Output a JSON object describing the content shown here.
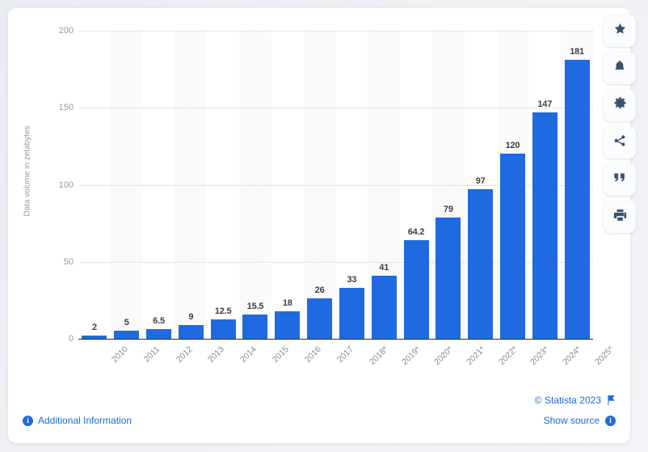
{
  "chart_data": {
    "type": "bar",
    "title": "",
    "subtitle": "",
    "xlabel": "",
    "ylabel": "Data volume in zetabytes",
    "ylim": [
      0,
      200
    ],
    "yticks": [
      0,
      50,
      100,
      150,
      200
    ],
    "ytick_labels": [
      "0",
      "50",
      "100",
      "150",
      "200"
    ],
    "grid": true,
    "legend": "none",
    "bar_color": "#1f6ae1",
    "categories": [
      "2010",
      "2011",
      "2012",
      "2013",
      "2014",
      "2015",
      "2016",
      "2017",
      "2018*",
      "2019*",
      "2020*",
      "2021*",
      "2022*",
      "2023*",
      "2024*",
      "2025*"
    ],
    "values": [
      2,
      5,
      6.5,
      9,
      12.5,
      15.5,
      18,
      26,
      33,
      41,
      64.2,
      79,
      97,
      120,
      147,
      181
    ],
    "value_labels": [
      "2",
      "5",
      "6.5",
      "9",
      "12.5",
      "15.5",
      "18",
      "26",
      "33",
      "41",
      "64.2",
      "79",
      "97",
      "120",
      "147",
      "181"
    ],
    "footnote_marker": "*"
  },
  "footer": {
    "additional_information": "Additional Information",
    "copyright": "© Statista 2023",
    "show_source": "Show source",
    "info_glyph": "i"
  },
  "icon_rail": {
    "items": [
      {
        "name": "favorite-star-icon",
        "label": "Add to favorites"
      },
      {
        "name": "notification-bell-icon",
        "label": "Create alert"
      },
      {
        "name": "settings-gear-icon",
        "label": "Settings"
      },
      {
        "name": "share-icon",
        "label": "Share"
      },
      {
        "name": "citation-quote-icon",
        "label": "Cite"
      },
      {
        "name": "print-icon",
        "label": "Print"
      }
    ]
  },
  "colors": {
    "bar": "#1f6ae1",
    "link": "#1f6ae1",
    "axis_text": "#8d8d8d",
    "label_text": "#404040",
    "band": "#fafafa",
    "page_bg": "#eceef2"
  }
}
